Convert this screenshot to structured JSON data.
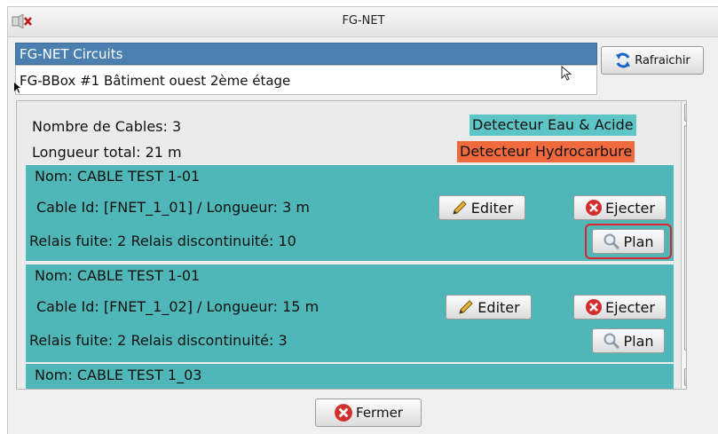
{
  "window": {
    "title": "FG-NET"
  },
  "combo": {
    "selected_label": "FG-NET Circuits",
    "item_label": "FG-BBox #1 Bâtiment ouest 2ème étage"
  },
  "toolbar": {
    "refresh_label": "Rafraichir",
    "close_label": "Fermer"
  },
  "summary": {
    "cable_count": "Nombre de Cables: 3",
    "total_length": "Longueur total: 21 m",
    "badge_water": "Detecteur Eau & Acide",
    "badge_hydro": "Detecteur Hydrocarbure"
  },
  "colors": {
    "teal": "#50b7b8",
    "water_badge": "#5ec5c6",
    "hydro_badge": "#f06a3e",
    "accent_ring": "#e0202a"
  },
  "cables": [
    {
      "name": "Nom: CABLE TEST 1-01",
      "id_length": "Cable Id: [FNET_1_01] / Longueur: 3 m",
      "relays": "Relais fuite: 2  Relais discontinuité: 10",
      "edit": "Editer",
      "eject": "Ejecter",
      "plan": "Plan"
    },
    {
      "name": "Nom: CABLE TEST 1-01",
      "id_length": "Cable Id: [FNET_1_02] / Longueur: 15 m",
      "relays": "Relais fuite: 2  Relais discontinuité: 3",
      "edit": "Editer",
      "eject": "Ejecter",
      "plan": "Plan"
    },
    {
      "name": "Nom: CABLE TEST 1_03"
    }
  ]
}
